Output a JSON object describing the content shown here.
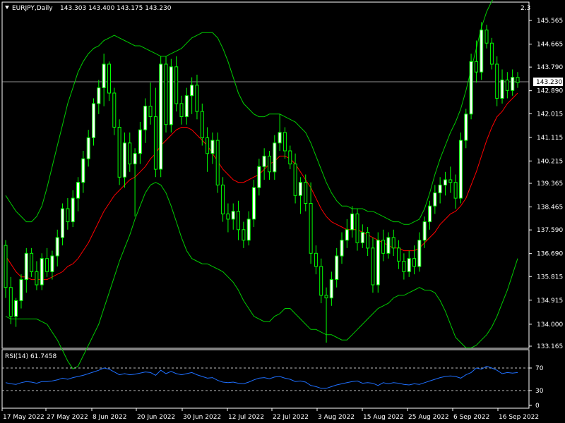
{
  "header": {
    "symbol_label": "EURJPY,Daily",
    "ohlc_label": "143.303 143.400 143.175 143.230",
    "corner_label": "2.3"
  },
  "colors": {
    "background": "#000000",
    "bull_candle": "#ffffff",
    "bear_candle": "#000000",
    "wick": "#00ff00",
    "bollinger": "#00cc00",
    "moving_average": "#ff0000",
    "rsi_line": "#1e6fff",
    "axis": "#ffffff"
  },
  "rsi": {
    "label": "RSI(14) 61.7458"
  },
  "chart_data": [
    {
      "type": "candlestick",
      "title": "EURJPY,Daily",
      "price_axis_ticks": [
        "145.565",
        "144.665",
        "143.790",
        "142.890",
        "142.015",
        "141.115",
        "140.215",
        "139.365",
        "138.465",
        "137.590",
        "136.690",
        "135.815",
        "134.915",
        "134.000",
        "133.165"
      ],
      "price_axis_values": [
        145.565,
        144.665,
        143.79,
        142.89,
        142.015,
        141.115,
        140.215,
        139.365,
        138.465,
        137.59,
        136.69,
        135.815,
        134.915,
        134.0,
        133.165
      ],
      "date_labels": [
        "17 May 2022",
        "27 May 2022",
        "8 Jun 2022",
        "20 Jun 2022",
        "30 Jun 2022",
        "12 Jul 2022",
        "22 Jul 2022",
        "3 Aug 2022",
        "15 Aug 2022",
        "25 Aug 2022",
        "6 Sep 2022",
        "16 Sep 2022"
      ],
      "current_price": 143.23,
      "current_price_label": "143.230",
      "ylim": [
        133.0,
        146.0
      ],
      "ohlc": [
        [
          137.0,
          137.2,
          135.0,
          135.4
        ],
        [
          135.4,
          135.8,
          134.0,
          134.3
        ],
        [
          134.3,
          135.0,
          133.9,
          134.9
        ],
        [
          134.9,
          135.9,
          134.6,
          135.7
        ],
        [
          135.7,
          136.9,
          135.2,
          136.7
        ],
        [
          136.7,
          136.9,
          135.8,
          136.0
        ],
        [
          136.0,
          136.4,
          135.3,
          135.5
        ],
        [
          135.5,
          136.7,
          135.3,
          136.5
        ],
        [
          136.5,
          136.9,
          135.8,
          136.0
        ],
        [
          136.0,
          136.8,
          135.7,
          136.6
        ],
        [
          136.6,
          137.6,
          136.2,
          137.3
        ],
        [
          137.3,
          138.6,
          137.0,
          138.4
        ],
        [
          138.4,
          138.8,
          137.6,
          137.9
        ],
        [
          137.9,
          139.1,
          137.7,
          138.8
        ],
        [
          138.8,
          139.6,
          138.3,
          139.4
        ],
        [
          139.4,
          140.6,
          139.0,
          140.3
        ],
        [
          140.3,
          141.4,
          140.0,
          141.1
        ],
        [
          141.1,
          142.6,
          140.8,
          142.4
        ],
        [
          142.4,
          143.3,
          142.0,
          143.0
        ],
        [
          143.0,
          144.3,
          142.3,
          143.9
        ],
        [
          143.9,
          144.0,
          142.5,
          142.8
        ],
        [
          142.8,
          143.0,
          141.2,
          141.5
        ],
        [
          141.5,
          141.8,
          139.3,
          139.6
        ],
        [
          139.6,
          141.3,
          139.2,
          140.9
        ],
        [
          140.9,
          141.3,
          139.8,
          140.1
        ],
        [
          140.1,
          140.7,
          138.1,
          140.5
        ],
        [
          140.5,
          141.7,
          140.1,
          141.4
        ],
        [
          141.4,
          142.6,
          140.9,
          142.3
        ],
        [
          142.3,
          143.2,
          141.6,
          141.9
        ],
        [
          141.9,
          143.0,
          139.6,
          139.9
        ],
        [
          139.9,
          144.2,
          139.6,
          143.9
        ],
        [
          143.9,
          144.2,
          141.3,
          141.6
        ],
        [
          141.6,
          144.1,
          141.3,
          143.8
        ],
        [
          143.8,
          144.2,
          142.1,
          142.4
        ],
        [
          142.4,
          142.7,
          141.6,
          141.9
        ],
        [
          141.9,
          143.0,
          141.6,
          142.7
        ],
        [
          142.7,
          143.4,
          142.0,
          143.1
        ],
        [
          143.1,
          143.5,
          141.8,
          142.1
        ],
        [
          142.1,
          142.4,
          140.8,
          141.1
        ],
        [
          141.1,
          141.5,
          139.8,
          140.5
        ],
        [
          140.5,
          141.3,
          140.1,
          141.0
        ],
        [
          141.0,
          141.3,
          139.0,
          139.3
        ],
        [
          139.3,
          139.6,
          137.9,
          138.2
        ],
        [
          138.2,
          138.6,
          137.5,
          138.0
        ],
        [
          138.0,
          138.6,
          137.6,
          138.3
        ],
        [
          138.3,
          138.7,
          137.2,
          137.6
        ],
        [
          137.6,
          137.9,
          136.9,
          137.2
        ],
        [
          137.2,
          138.3,
          137.0,
          138.0
        ],
        [
          138.0,
          139.5,
          137.7,
          139.2
        ],
        [
          139.2,
          140.3,
          138.9,
          140.0
        ],
        [
          140.0,
          140.7,
          139.5,
          140.4
        ],
        [
          140.4,
          140.6,
          139.5,
          139.8
        ],
        [
          139.8,
          141.2,
          139.5,
          140.9
        ],
        [
          140.9,
          142.0,
          140.6,
          141.3
        ],
        [
          141.3,
          141.5,
          140.3,
          140.6
        ],
        [
          140.6,
          140.8,
          139.9,
          140.1
        ],
        [
          140.1,
          140.5,
          138.6,
          138.9
        ],
        [
          138.9,
          139.6,
          138.2,
          139.4
        ],
        [
          139.4,
          139.7,
          138.3,
          138.6
        ],
        [
          138.6,
          139.4,
          136.3,
          136.7
        ],
        [
          136.7,
          137.0,
          135.9,
          136.2
        ],
        [
          136.2,
          136.5,
          134.8,
          135.1
        ],
        [
          135.1,
          135.4,
          133.3,
          135.0
        ],
        [
          135.0,
          136.0,
          134.7,
          135.7
        ],
        [
          135.7,
          136.9,
          135.4,
          136.6
        ],
        [
          136.6,
          137.5,
          136.3,
          137.2
        ],
        [
          137.2,
          138.0,
          136.9,
          137.6
        ],
        [
          137.6,
          138.5,
          137.3,
          138.2
        ],
        [
          138.2,
          138.4,
          136.8,
          137.1
        ],
        [
          137.1,
          137.8,
          136.9,
          137.5
        ],
        [
          137.5,
          137.7,
          136.6,
          136.9
        ],
        [
          136.9,
          137.3,
          135.2,
          135.5
        ],
        [
          135.5,
          137.5,
          135.2,
          137.2
        ],
        [
          137.2,
          137.6,
          136.4,
          136.7
        ],
        [
          136.7,
          137.5,
          136.5,
          137.3
        ],
        [
          137.3,
          137.6,
          136.6,
          136.9
        ],
        [
          136.9,
          137.2,
          136.1,
          136.4
        ],
        [
          136.4,
          136.7,
          135.7,
          136.0
        ],
        [
          136.0,
          136.8,
          135.8,
          136.5
        ],
        [
          136.5,
          137.0,
          135.9,
          136.2
        ],
        [
          136.2,
          137.5,
          136.0,
          137.2
        ],
        [
          137.2,
          138.1,
          136.9,
          137.9
        ],
        [
          137.9,
          138.7,
          137.6,
          138.5
        ],
        [
          138.5,
          139.3,
          138.2,
          139.0
        ],
        [
          139.0,
          139.6,
          138.6,
          139.3
        ],
        [
          139.3,
          139.8,
          138.9,
          139.5
        ],
        [
          139.5,
          140.0,
          139.0,
          139.4
        ],
        [
          139.4,
          139.7,
          138.4,
          138.8
        ],
        [
          138.8,
          141.3,
          138.6,
          141.0
        ],
        [
          141.0,
          142.2,
          140.7,
          142.0
        ],
        [
          142.0,
          144.3,
          141.8,
          144.0
        ],
        [
          144.0,
          144.8,
          143.2,
          143.6
        ],
        [
          143.6,
          145.5,
          143.3,
          145.2
        ],
        [
          145.2,
          145.4,
          144.5,
          144.7
        ],
        [
          144.7,
          144.9,
          143.7,
          143.9
        ],
        [
          143.9,
          144.2,
          142.3,
          142.6
        ],
        [
          142.6,
          143.7,
          142.4,
          143.3
        ],
        [
          143.3,
          143.6,
          142.6,
          142.9
        ],
        [
          142.9,
          143.7,
          142.7,
          143.4
        ],
        [
          143.4,
          143.6,
          143.0,
          143.2
        ]
      ],
      "ma": [
        136.6,
        136.3,
        136.0,
        135.8,
        135.8,
        135.7,
        135.7,
        135.7,
        135.7,
        135.8,
        135.9,
        136.0,
        136.2,
        136.3,
        136.5,
        136.8,
        137.1,
        137.5,
        137.9,
        138.3,
        138.6,
        138.9,
        139.1,
        139.3,
        139.5,
        139.6,
        139.8,
        140.0,
        140.3,
        140.5,
        140.8,
        141.0,
        141.2,
        141.4,
        141.5,
        141.5,
        141.4,
        141.2,
        141.0,
        140.8,
        140.5,
        140.2,
        139.9,
        139.7,
        139.5,
        139.4,
        139.4,
        139.5,
        139.6,
        139.7,
        139.9,
        140.1,
        140.2,
        140.4,
        140.4,
        140.3,
        140.1,
        139.8,
        139.5,
        139.2,
        138.8,
        138.4,
        138.1,
        137.9,
        137.8,
        137.7,
        137.6,
        137.6,
        137.6,
        137.5,
        137.4,
        137.3,
        137.2,
        137.1,
        137.0,
        136.9,
        136.9,
        136.8,
        136.8,
        136.8,
        136.9,
        137.1,
        137.3,
        137.5,
        137.8,
        138.0,
        138.2,
        138.3,
        138.5,
        138.8,
        139.3,
        139.8,
        140.4,
        141.0,
        141.5,
        141.9,
        142.1,
        142.4,
        142.6,
        142.8
      ],
      "bb_upper": [
        138.9,
        138.6,
        138.3,
        138.1,
        137.9,
        137.9,
        138.1,
        138.5,
        139.2,
        140.0,
        140.8,
        141.6,
        142.4,
        143.0,
        143.6,
        144.0,
        144.3,
        144.5,
        144.6,
        144.8,
        144.9,
        145.0,
        144.9,
        144.8,
        144.7,
        144.6,
        144.6,
        144.5,
        144.4,
        144.3,
        144.2,
        144.2,
        144.3,
        144.4,
        144.5,
        144.7,
        144.9,
        145.0,
        145.1,
        145.1,
        145.1,
        144.9,
        144.5,
        144.0,
        143.4,
        142.8,
        142.4,
        142.2,
        142.0,
        141.9,
        141.9,
        142.0,
        142.0,
        142.0,
        141.9,
        141.8,
        141.7,
        141.5,
        141.3,
        140.9,
        140.4,
        139.9,
        139.4,
        139.0,
        138.7,
        138.5,
        138.5,
        138.4,
        138.4,
        138.4,
        138.3,
        138.3,
        138.2,
        138.1,
        138.0,
        137.9,
        137.9,
        137.8,
        137.8,
        137.9,
        138.0,
        138.4,
        139.0,
        139.7,
        140.3,
        140.8,
        141.3,
        141.7,
        142.2,
        142.9,
        143.7,
        144.5,
        145.3,
        145.9,
        146.3,
        146.6,
        146.9,
        147.1,
        147.3,
        147.5
      ],
      "bb_lower": [
        134.3,
        134.2,
        134.2,
        134.2,
        134.2,
        134.2,
        134.2,
        134.1,
        134.0,
        133.7,
        133.4,
        133.0,
        132.6,
        132.3,
        132.4,
        132.8,
        133.2,
        133.6,
        134.0,
        134.6,
        135.2,
        135.8,
        136.4,
        136.9,
        137.4,
        138.0,
        138.5,
        139.0,
        139.3,
        139.4,
        139.3,
        139.0,
        138.5,
        137.9,
        137.3,
        136.8,
        136.5,
        136.4,
        136.3,
        136.3,
        136.2,
        136.1,
        136.0,
        135.8,
        135.6,
        135.3,
        134.9,
        134.6,
        134.3,
        134.2,
        134.1,
        134.1,
        134.3,
        134.4,
        134.6,
        134.6,
        134.4,
        134.2,
        134.0,
        133.8,
        133.8,
        133.7,
        133.6,
        133.6,
        133.5,
        133.4,
        133.4,
        133.6,
        133.8,
        134.0,
        134.2,
        134.4,
        134.6,
        134.7,
        134.8,
        135.0,
        135.1,
        135.1,
        135.2,
        135.3,
        135.4,
        135.3,
        135.3,
        135.2,
        134.9,
        134.5,
        134.0,
        133.5,
        133.3,
        133.1,
        133.1,
        133.2,
        133.4,
        133.6,
        133.9,
        134.3,
        134.8,
        135.3,
        135.9,
        136.5
      ],
      "rsi_ticks": [
        "70",
        "30",
        "0"
      ],
      "rsi_levels": [
        70,
        30
      ],
      "rsi_ylim": [
        0,
        100
      ],
      "rsi_values": [
        44,
        42,
        41,
        44,
        46,
        45,
        43,
        46,
        46,
        47,
        49,
        52,
        50,
        53,
        55,
        57,
        60,
        63,
        66,
        70,
        68,
        63,
        58,
        60,
        58,
        59,
        61,
        63,
        62,
        57,
        66,
        60,
        64,
        60,
        58,
        60,
        62,
        58,
        55,
        52,
        53,
        48,
        45,
        44,
        45,
        43,
        42,
        45,
        49,
        52,
        53,
        51,
        54,
        55,
        52,
        50,
        46,
        47,
        45,
        39,
        37,
        34,
        34,
        37,
        40,
        42,
        44,
        46,
        47,
        43,
        44,
        43,
        39,
        44,
        42,
        44,
        43,
        41,
        40,
        42,
        41,
        44,
        47,
        50,
        53,
        55,
        56,
        55,
        52,
        58,
        62,
        70,
        68,
        73,
        70,
        66,
        60,
        62,
        61,
        62
      ]
    }
  ]
}
